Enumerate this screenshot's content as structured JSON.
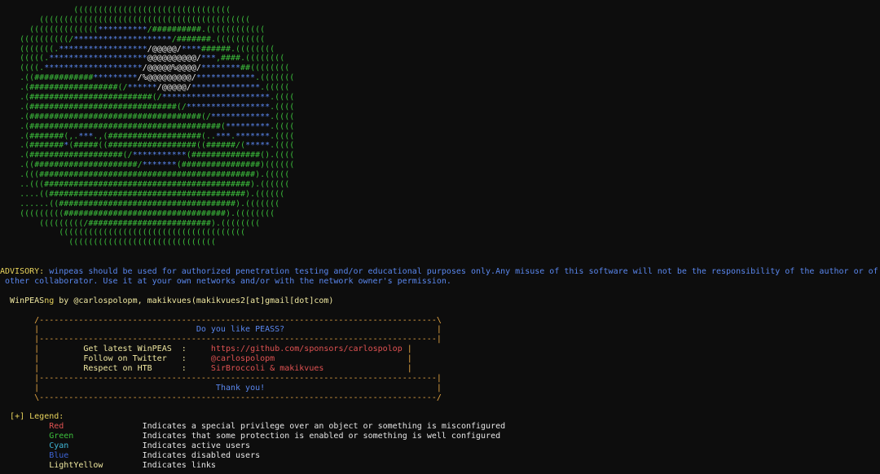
{
  "ascii_art": [
    [
      {
        "t": "               ((((((((((((((((((((((((((((((((",
        "c": "g"
      }
    ],
    [
      {
        "t": "        (((((((((((((((((((((((((((((((((((((((((((",
        "c": "g"
      }
    ],
    [
      {
        "t": "      ((((((((((((((",
        "c": "g"
      },
      {
        "t": "**********",
        "c": "b"
      },
      {
        "t": "/##########.((((((((((((",
        "c": "g"
      }
    ],
    [
      {
        "t": "    ((((((((((/",
        "c": "g"
      },
      {
        "t": "********************",
        "c": "b"
      },
      {
        "t": "/#######.((((((((((",
        "c": "g"
      }
    ],
    [
      {
        "t": "    (((((((.",
        "c": "g"
      },
      {
        "t": "******************",
        "c": "b"
      },
      {
        "t": "/@@@@@/",
        "c": "w"
      },
      {
        "t": "****",
        "c": "b"
      },
      {
        "t": "######.((((((((",
        "c": "g"
      }
    ],
    [
      {
        "t": "    (((((.",
        "c": "g"
      },
      {
        "t": "********************",
        "c": "b"
      },
      {
        "t": "@@@@@@@@@@/",
        "c": "w"
      },
      {
        "t": "***",
        "c": "b"
      },
      {
        "t": ",####.((((((((",
        "c": "g"
      }
    ],
    [
      {
        "t": "    ((((.",
        "c": "g"
      },
      {
        "t": "********************",
        "c": "b"
      },
      {
        "t": "/@@@@@%@@@@/",
        "c": "w"
      },
      {
        "t": "********",
        "c": "b"
      },
      {
        "t": "##((((((((",
        "c": "g"
      }
    ],
    [
      {
        "t": "    .((############",
        "c": "g"
      },
      {
        "t": "*********",
        "c": "b"
      },
      {
        "t": "/%@@@@@@@@@/",
        "c": "w"
      },
      {
        "t": "************",
        "c": "b"
      },
      {
        "t": ".(((((((",
        "c": "g"
      }
    ],
    [
      {
        "t": "    .(##################(/",
        "c": "g"
      },
      {
        "t": "******",
        "c": "b"
      },
      {
        "t": "/@@@@@/",
        "c": "w"
      },
      {
        "t": "**************",
        "c": "b"
      },
      {
        "t": ".(((((",
        "c": "g"
      }
    ],
    [
      {
        "t": "    .(#########################(/",
        "c": "g"
      },
      {
        "t": "**********************",
        "c": "b"
      },
      {
        "t": ".((((",
        "c": "g"
      }
    ],
    [
      {
        "t": "    .(##############################(/",
        "c": "g"
      },
      {
        "t": "*****************",
        "c": "b"
      },
      {
        "t": ".((((",
        "c": "g"
      }
    ],
    [
      {
        "t": "    .(###################################(/",
        "c": "g"
      },
      {
        "t": "************",
        "c": "b"
      },
      {
        "t": ".((((",
        "c": "g"
      }
    ],
    [
      {
        "t": "    .(#######################################(",
        "c": "g"
      },
      {
        "t": "*********",
        "c": "b"
      },
      {
        "t": ".((((",
        "c": "g"
      }
    ],
    [
      {
        "t": "    .(#######(,.",
        "c": "g"
      },
      {
        "t": "***",
        "c": "b"
      },
      {
        "t": ".,(###################(..",
        "c": "g"
      },
      {
        "t": "***",
        "c": "b"
      },
      {
        "t": ".",
        "c": "g"
      },
      {
        "t": "*******",
        "c": "b"
      },
      {
        "t": ".((((",
        "c": "g"
      }
    ],
    [
      {
        "t": "    .(#######",
        "c": "g"
      },
      {
        "t": "*",
        "c": "b"
      },
      {
        "t": "(#####((##################((######/(",
        "c": "g"
      },
      {
        "t": "*****",
        "c": "b"
      },
      {
        "t": ".((((",
        "c": "g"
      }
    ],
    [
      {
        "t": "    .(###################(/",
        "c": "g"
      },
      {
        "t": "***********",
        "c": "b"
      },
      {
        "t": "(##############().((((",
        "c": "g"
      }
    ],
    [
      {
        "t": "    .((#####################/",
        "c": "g"
      },
      {
        "t": "*******",
        "c": "b"
      },
      {
        "t": "(################)((((((",
        "c": "g"
      }
    ],
    [
      {
        "t": "    .(((############################################).(((((",
        "c": "g"
      }
    ],
    [
      {
        "t": "    ..(((##########################################).((((((",
        "c": "g"
      }
    ],
    [
      {
        "t": "    ....((########################################).((((((",
        "c": "g"
      }
    ],
    [
      {
        "t": "    ......((####################################).(((((((",
        "c": "g"
      }
    ],
    [
      {
        "t": "    (((((((((#################################).((((((((",
        "c": "g"
      }
    ],
    [
      {
        "t": "        (((((((((/#########################).((((((((",
        "c": "g"
      }
    ],
    [
      {
        "t": "            ((((((((((((((((((((((((((((((((((((((",
        "c": "g"
      }
    ],
    [
      {
        "t": "              ((((((((((((((((((((((((((((((",
        "c": "g"
      }
    ]
  ],
  "advisory": {
    "label": "ADVISORY:",
    "line1": " winpeas should be used for authorized penetration testing and/or educational purposes only.Any misuse of this software will not be the responsibility of the author or of any",
    "line2": " other collaborator. Use it at your own networks and/or with the network owner's permission."
  },
  "credits": {
    "name_a": "WinPEAS",
    "name_b": "ng",
    "rest": " by @carlospolopm, makikvues(makikvues2[at]gmail[dot]com)"
  },
  "box": {
    "top": "/---------------------------------------------------------------------------------\\",
    "sep": "|---------------------------------------------------------------------------------|",
    "bottom": "\\---------------------------------------------------------------------------------/",
    "title": "Do you like PEASS?",
    "rows": [
      {
        "label": "Get latest WinPEAS",
        "colon": ":",
        "value": "https://github.com/sponsors/carlospolop"
      },
      {
        "label": "Follow on Twitter",
        "colon": ":",
        "value": "@carlospolopm"
      },
      {
        "label": "Respect on HTB",
        "colon": ":",
        "value": "SirBroccoli & makikvues"
      }
    ],
    "thanks": "Thank you!"
  },
  "legend": {
    "header": "[+] Legend:",
    "items": [
      {
        "name": "Red",
        "desc": "Indicates a special privilege over an object or something is misconfigured",
        "color": "#e05252"
      },
      {
        "name": "Green",
        "desc": "Indicates that some protection is enabled or something is well configured",
        "color": "#3cbf3c"
      },
      {
        "name": "Cyan",
        "desc": "Indicates active users",
        "color": "#3fb6d6"
      },
      {
        "name": "Blue",
        "desc": "Indicates disabled users",
        "color": "#3d63d4"
      },
      {
        "name": "LightYellow",
        "desc": "Indicates links",
        "color": "#f0e8a0"
      }
    ]
  }
}
